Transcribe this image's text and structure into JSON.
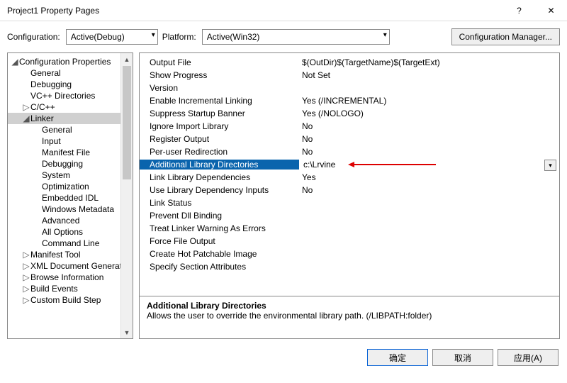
{
  "window": {
    "title": "Project1 Property Pages"
  },
  "top": {
    "config_label": "Configuration:",
    "config_value": "Active(Debug)",
    "platform_label": "Platform:",
    "platform_value": "Active(Win32)",
    "cfg_manager": "Configuration Manager..."
  },
  "tree": {
    "root": "Configuration Properties",
    "items1": [
      "General",
      "Debugging",
      "VC++ Directories"
    ],
    "cpp": "C/C++",
    "linker": "Linker",
    "linker_children": [
      "General",
      "Input",
      "Manifest File",
      "Debugging",
      "System",
      "Optimization",
      "Embedded IDL",
      "Windows Metadata",
      "Advanced",
      "All Options",
      "Command Line"
    ],
    "rest": [
      "Manifest Tool",
      "XML Document Generator",
      "Browse Information",
      "Build Events",
      "Custom Build Step"
    ]
  },
  "grid": [
    {
      "label": "Output File",
      "value": "$(OutDir)$(TargetName)$(TargetExt)"
    },
    {
      "label": "Show Progress",
      "value": "Not Set"
    },
    {
      "label": "Version",
      "value": ""
    },
    {
      "label": "Enable Incremental Linking",
      "value": "Yes (/INCREMENTAL)"
    },
    {
      "label": "Suppress Startup Banner",
      "value": "Yes (/NOLOGO)"
    },
    {
      "label": "Ignore Import Library",
      "value": "No"
    },
    {
      "label": "Register Output",
      "value": "No"
    },
    {
      "label": "Per-user Redirection",
      "value": "No"
    },
    {
      "label": "Additional Library Directories",
      "value": "c:\\Lrvine"
    },
    {
      "label": "Link Library Dependencies",
      "value": "Yes"
    },
    {
      "label": "Use Library Dependency Inputs",
      "value": "No"
    },
    {
      "label": "Link Status",
      "value": ""
    },
    {
      "label": "Prevent Dll Binding",
      "value": ""
    },
    {
      "label": "Treat Linker Warning As Errors",
      "value": ""
    },
    {
      "label": "Force File Output",
      "value": ""
    },
    {
      "label": "Create Hot Patchable Image",
      "value": ""
    },
    {
      "label": "Specify Section Attributes",
      "value": ""
    }
  ],
  "selected_index": 8,
  "desc": {
    "title": "Additional Library Directories",
    "text": "Allows the user to override the environmental library path. (/LIBPATH:folder)"
  },
  "buttons": {
    "ok": "确定",
    "cancel": "取消",
    "apply": "应用(A)"
  }
}
